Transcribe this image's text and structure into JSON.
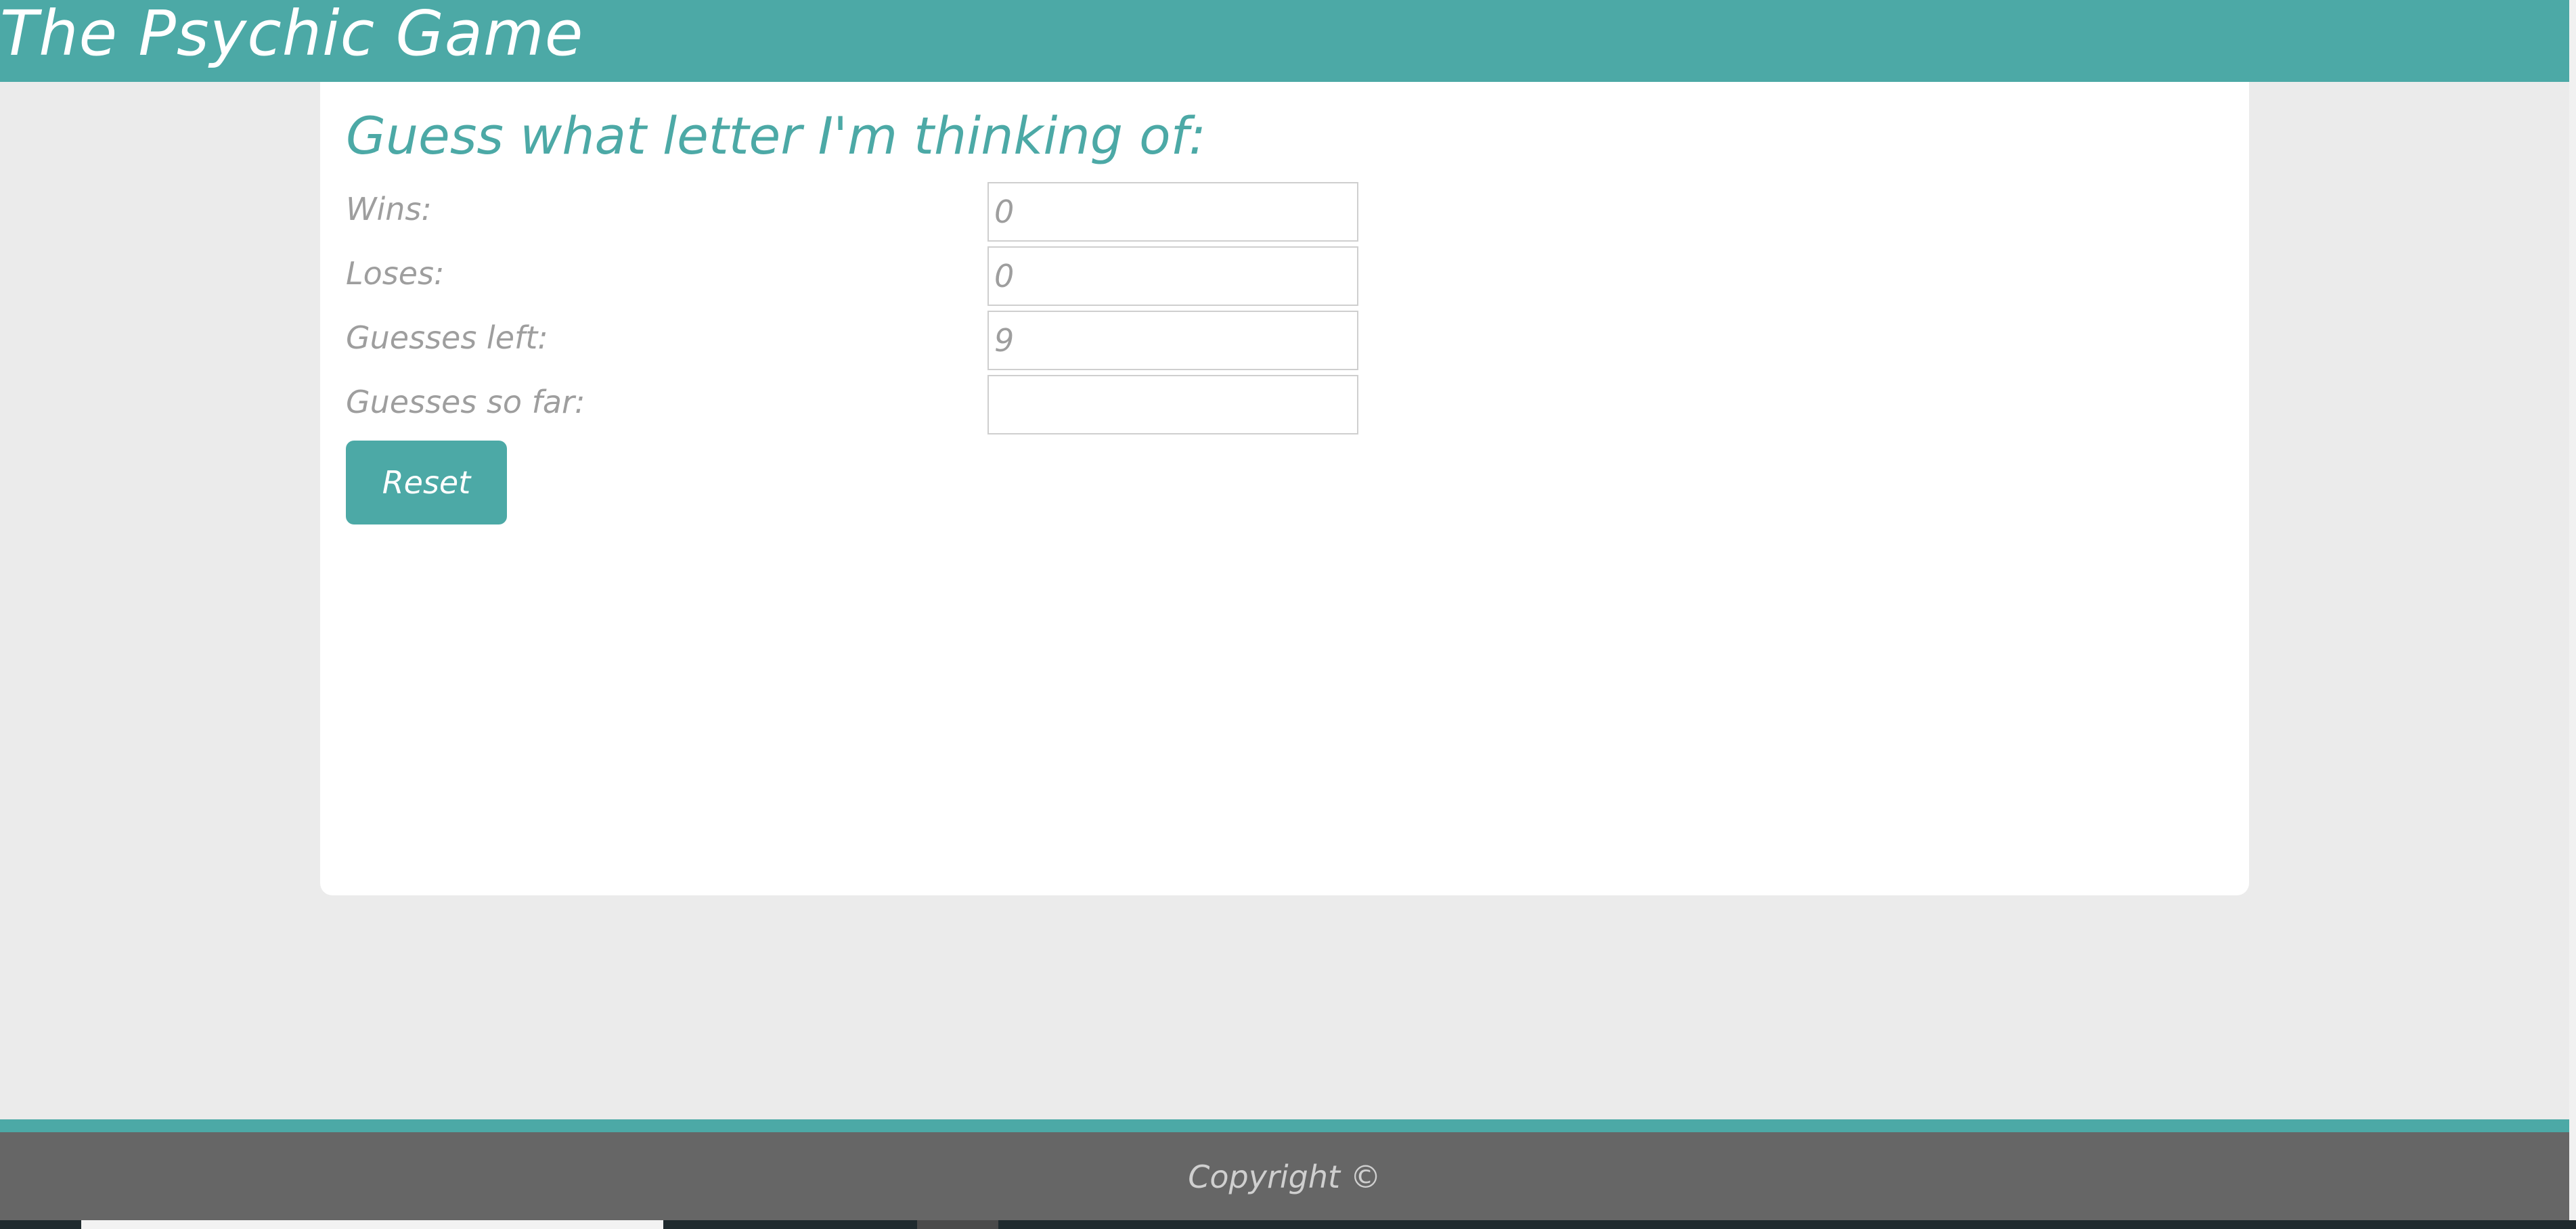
{
  "header": {
    "title": "The Psychic Game"
  },
  "game": {
    "heading": "Guess what letter I'm thinking of:",
    "stats": [
      {
        "label": "Wins:",
        "value": "0"
      },
      {
        "label": "Loses:",
        "value": "0"
      },
      {
        "label": "Guesses left:",
        "value": "9"
      },
      {
        "label": "Guesses so far:",
        "value": ""
      }
    ],
    "reset_label": "Reset"
  },
  "footer": {
    "copyright": "Copyright ©"
  },
  "colors": {
    "accent": "#4ca9a6",
    "background": "#ebebeb",
    "footer": "#666666"
  }
}
